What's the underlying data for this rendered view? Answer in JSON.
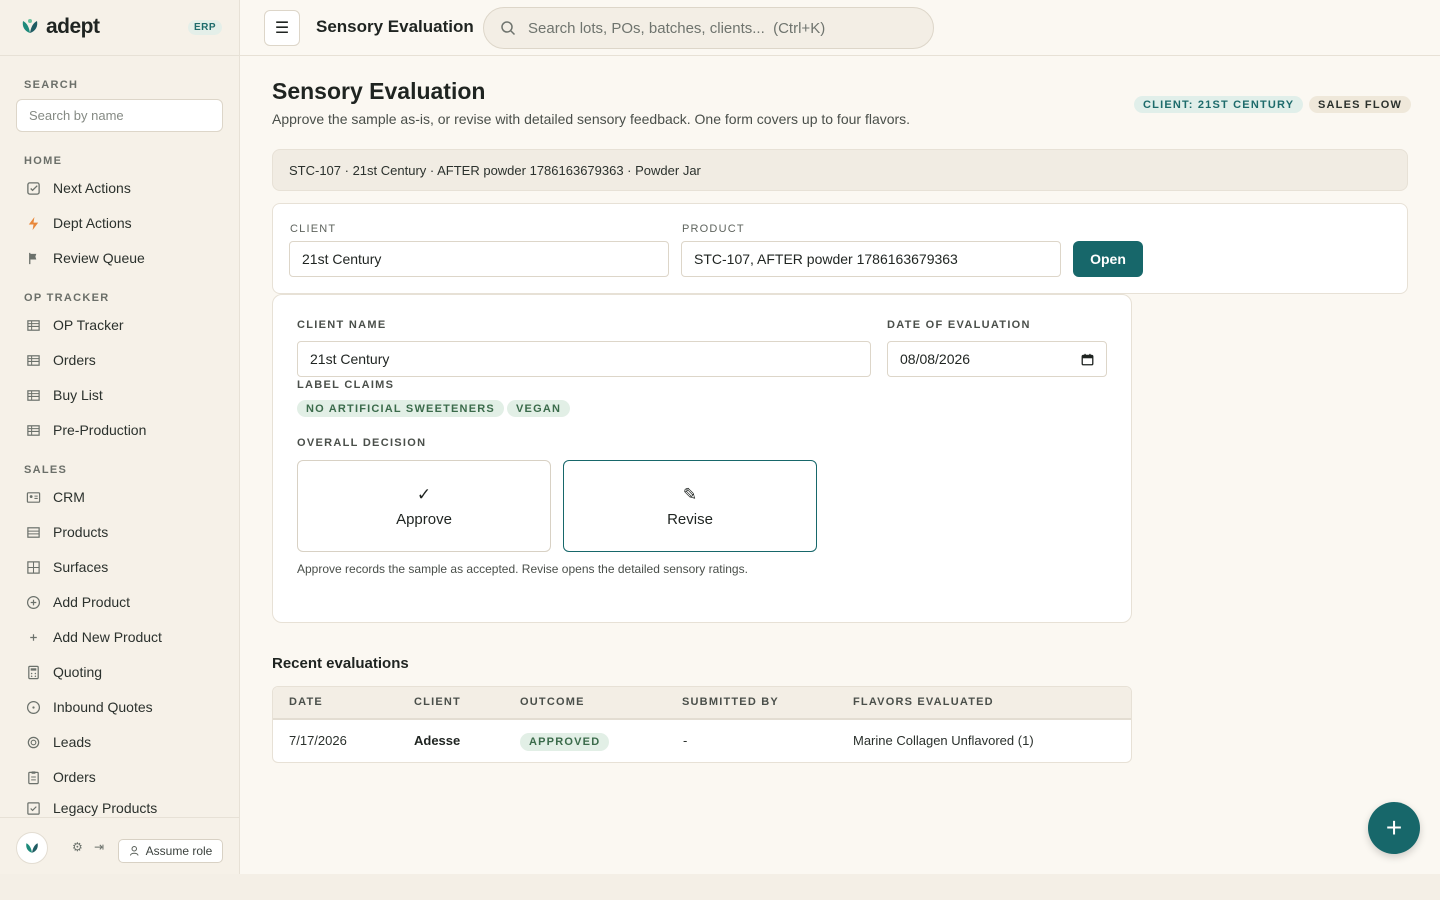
{
  "brand": {
    "name": "adept",
    "badge": "ERP"
  },
  "sidebar": {
    "search_label": "SEARCH",
    "search_placeholder": "Search by name",
    "sections": {
      "home": "HOME",
      "op_tracker": "OP TRACKER",
      "sales": "SALES"
    },
    "home_items": [
      {
        "label": "Next Actions",
        "icon": "check-square-icon"
      },
      {
        "label": "Dept Actions",
        "icon": "bolt-icon"
      },
      {
        "label": "Review Queue",
        "icon": "flag-icon"
      }
    ],
    "op_items": [
      {
        "label": "OP Tracker",
        "icon": "table-icon"
      },
      {
        "label": "Orders",
        "icon": "table-icon"
      },
      {
        "label": "Buy List",
        "icon": "table-icon"
      },
      {
        "label": "Pre-Production",
        "icon": "table-icon"
      }
    ],
    "sales_items": [
      {
        "label": "CRM",
        "icon": "contact-card-icon"
      },
      {
        "label": "Products",
        "icon": "list-icon"
      },
      {
        "label": "Surfaces",
        "icon": "grid-icon"
      },
      {
        "label": "Add Product",
        "icon": "plus-circle-icon"
      },
      {
        "label": "Add New Product",
        "icon": "plus-icon"
      },
      {
        "label": "Quoting",
        "icon": "calculator-icon"
      },
      {
        "label": "Inbound Quotes",
        "icon": "circle-dot-icon"
      },
      {
        "label": "Leads",
        "icon": "target-icon"
      },
      {
        "label": "Orders",
        "icon": "clipboard-icon"
      },
      {
        "label": "Legacy Products",
        "icon": "checkbox-icon"
      }
    ],
    "footer": {
      "assume_role": "Assume role"
    }
  },
  "topbar": {
    "title": "Sensory Evaluation",
    "search_placeholder": "Search lots, POs, batches, clients...  (Ctrl+K)"
  },
  "page": {
    "title": "Sensory Evaluation",
    "subtitle": "Approve the sample as-is, or revise with detailed sensory feedback. One form covers up to four flavors.",
    "chips": {
      "client": "CLIENT: 21ST CENTURY",
      "flow": "SALES FLOW"
    },
    "info_strip": "STC-107 · 21st Century · AFTER powder 1786163679363 · Powder Jar"
  },
  "lookup": {
    "client_label": "CLIENT",
    "client_value": "21st Century",
    "product_label": "PRODUCT",
    "product_value": "STC-107, AFTER powder 1786163679363",
    "open_button": "Open"
  },
  "evaluation": {
    "client_name_label": "CLIENT NAME",
    "client_name_value": "21st Century",
    "date_label": "DATE OF EVALUATION",
    "date_value": "08/08/2026",
    "label_claims_label": "LABEL CLAIMS",
    "claims": [
      "NO ARTIFICIAL SWEETENERS",
      "VEGAN"
    ],
    "decision_label": "OVERALL DECISION",
    "approve_label": "Approve",
    "approve_icon": "✓",
    "revise_label": "Revise",
    "revise_icon": "✎",
    "selected": "Revise",
    "hint": "Approve records the sample as accepted. Revise opens the detailed sensory ratings."
  },
  "recent": {
    "title": "Recent evaluations",
    "columns": [
      "DATE",
      "CLIENT",
      "OUTCOME",
      "SUBMITTED BY",
      "FLAVORS EVALUATED"
    ],
    "rows": [
      {
        "date": "7/17/2026",
        "client": "Adesse",
        "outcome": "APPROVED",
        "submitted_by": "-",
        "flavors": "Marine Collagen Unflavored (1)"
      }
    ]
  },
  "fab_icon": "+",
  "colors": {
    "accent": "#17676a",
    "background": "#fbf8f2",
    "sidebar": "#f6f1e8"
  }
}
